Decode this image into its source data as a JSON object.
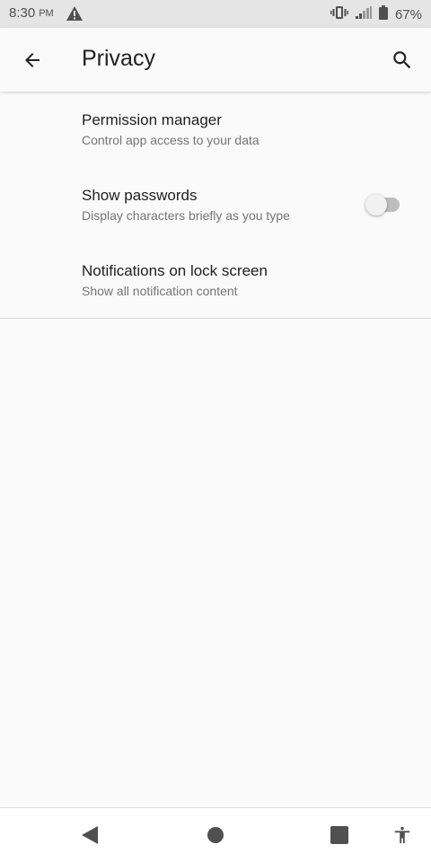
{
  "status_bar": {
    "time": "8:30",
    "ampm": "PM",
    "battery": "67%",
    "icons": [
      "warning-icon",
      "vibrate-icon",
      "signal-icon",
      "battery-icon"
    ]
  },
  "toolbar": {
    "title": "Privacy",
    "back_icon": "arrow-back-icon",
    "search_icon": "search-icon"
  },
  "items": [
    {
      "title": "Permission manager",
      "summary": "Control app access to your data"
    },
    {
      "title": "Show passwords",
      "summary": "Display characters briefly as you type",
      "toggle_on": false
    },
    {
      "title": "Notifications on lock screen",
      "summary": "Show all notification content"
    }
  ],
  "nav_bar": {
    "icons": [
      "back-triangle-icon",
      "home-circle-icon",
      "recents-square-icon",
      "accessibility-icon"
    ]
  },
  "colors": {
    "status_bar_bg": "#e5e5e5",
    "background": "#fafafa",
    "primary_text": "#212121",
    "secondary_text": "#757575",
    "toggle_track": "#bdbdbd",
    "toggle_thumb": "#f1f1f1"
  }
}
